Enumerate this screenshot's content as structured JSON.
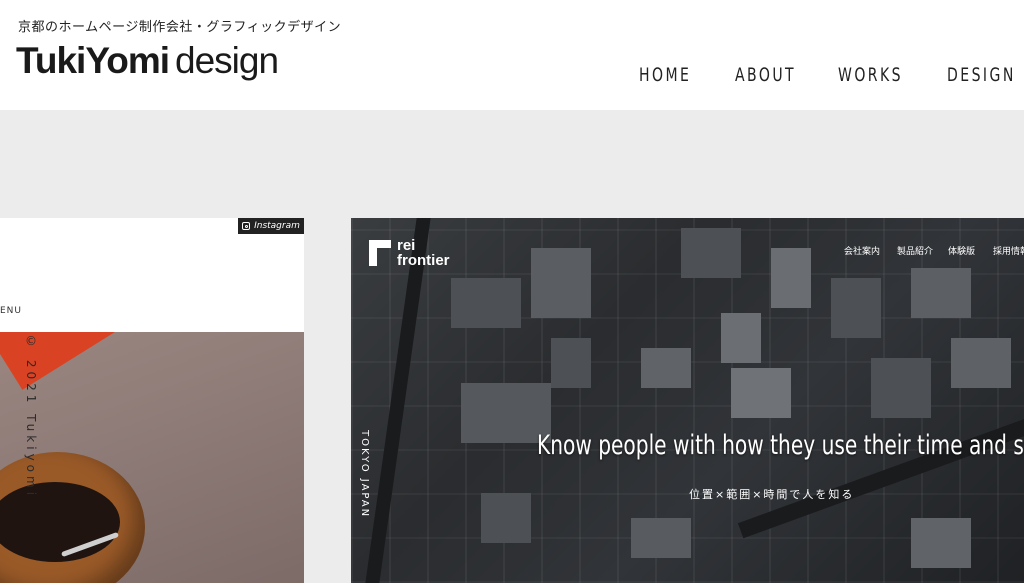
{
  "header": {
    "tagline": "京都のホームページ制作会社・グラフィックデザイン",
    "logo_strong": "TukiYomi",
    "logo_light": "design",
    "nav": [
      "HOME",
      "ABOUT",
      "WORKS",
      "DESIGN"
    ]
  },
  "card_left": {
    "instagram_label": "Instagram",
    "menu_label": "ENU",
    "vertical_copy": "© 2021 Tukiyomi"
  },
  "card_right": {
    "logo_line1": "rei",
    "logo_line2": "frontier",
    "nav": [
      "会社案内",
      "製品紹介",
      "体験版",
      "採用情報"
    ],
    "headline": "Know people with how they use their time and space.",
    "subheadline": "位置×範囲×時間で人を知る",
    "vertical_label": "TOKYO JAPAN"
  },
  "colors": {
    "header_bg": "#ffffff",
    "page_bg": "#ececec",
    "accent_red": "#d94323",
    "badge_bg": "#222222"
  }
}
